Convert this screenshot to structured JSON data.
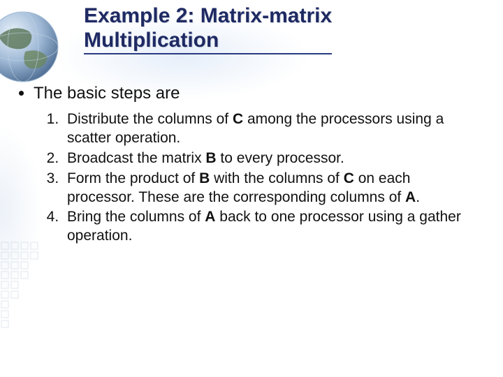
{
  "title_line1": "Example 2: Matrix-matrix",
  "title_line2": "Multiplication",
  "intro_bullet": "The basic steps are",
  "steps": {
    "s1a": "Distribute the columns of ",
    "s1b": "C",
    "s1c": " among the processors using a scatter operation.",
    "s2a": "Broadcast the matrix ",
    "s2b": "B",
    "s2c": " to every processor.",
    "s3a": "Form the product of ",
    "s3b": "B",
    "s3c": " with the columns of ",
    "s3d": "C",
    "s3e": " on each processor. These are the corresponding columns of ",
    "s3f": "A",
    "s3g": ".",
    "s4a": "Bring the columns of ",
    "s4b": "A",
    "s4c": " back to one processor using a gather operation."
  }
}
